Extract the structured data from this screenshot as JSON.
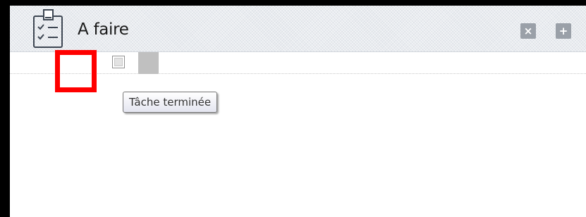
{
  "panel": {
    "title": "A faire",
    "icon": "clipboard-checklist-icon",
    "buttons": {
      "close": {
        "label": "×",
        "icon": "close-icon"
      },
      "add": {
        "label": "+",
        "icon": "plus-icon"
      }
    }
  },
  "task": {
    "checkbox_checked": false,
    "tooltip": "Tâche terminée"
  },
  "colors": {
    "highlight": "#ff0000",
    "header_button": "#9aa0a8",
    "background": "#000000"
  }
}
